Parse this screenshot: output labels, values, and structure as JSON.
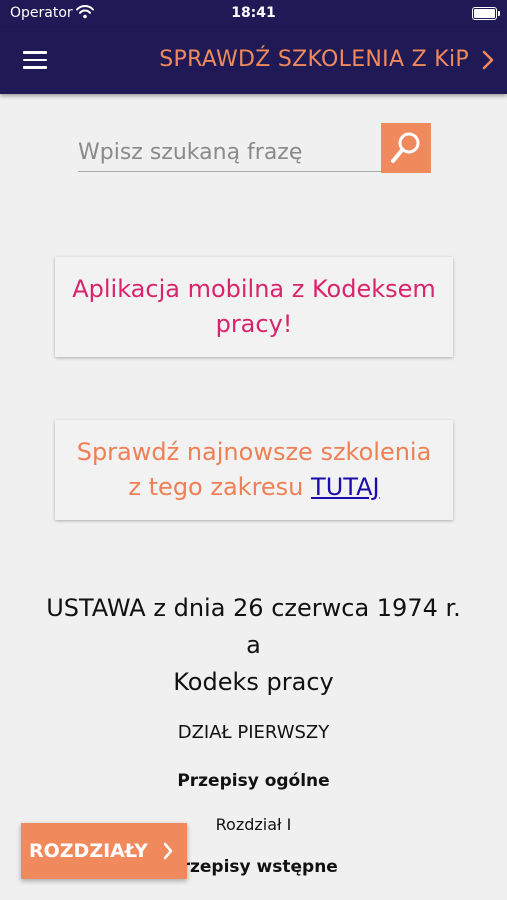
{
  "status_bar": {
    "carrier": "Operator",
    "time": "18:41"
  },
  "nav": {
    "title": "SPRAWDŹ SZKOLENIA Z KiP"
  },
  "search": {
    "placeholder": "Wpisz szukaną frazę"
  },
  "promo_app": {
    "line1": "Aplikacja mobilna z Kodeksem",
    "line2": "pracy!"
  },
  "promo_training": {
    "line1": "Sprawdź najnowsze szkolenia",
    "line2": "z tego zakresu",
    "link": "TUTAJ"
  },
  "document": {
    "title_line1": "USTAWA z dnia 26 czerwca 1974 r.",
    "title_line2": "a",
    "title_line3": "Kodeks pracy",
    "division": "DZIAŁ PIERWSZY",
    "provisions": "Przepisy ogólne",
    "chapter": "Rozdział I",
    "chapter_title": "Przepisy wstępne"
  },
  "chapters_button": {
    "label": "ROZDZIAŁY"
  },
  "colors": {
    "navy": "#1f1a55",
    "orange": "#f08a5d",
    "pink": "#d9246d",
    "link": "#1a0dab"
  }
}
